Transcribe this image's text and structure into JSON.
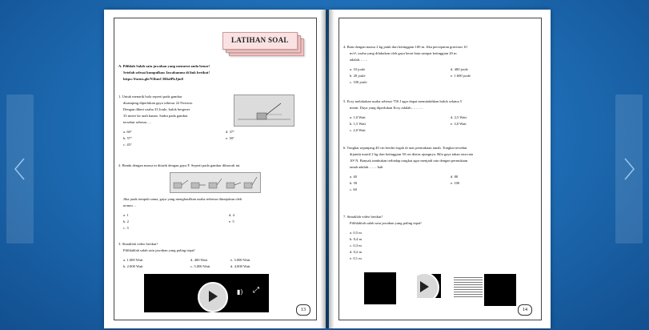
{
  "viewer": {
    "prev_icon": "chevron-left-icon",
    "next_icon": "chevron-right-icon"
  },
  "left_page": {
    "banner_title": "LATIHAN SOAL",
    "instruction_a": "A.  Pilihlah Salah satu jawaban yang menurut anda benar!",
    "instruction_b": "Setelah selesai kumpulkan Jawabanmu di link berikut!",
    "link": "https://forms.gle/N3hmC3RkdPkJjm8",
    "q1": [
      "1.  Untuk  menarik  bola  seperti  pada  gambar",
      "disamping diperlukan gaya sebesar 22 Newton.",
      "Dengan diberi usaha 33 Joule, balok bergeser",
      "33  meter  ke  arah  kanan.  Sudut  pada  gambar",
      "tersebut sebesar…."
    ],
    "q1_opts": [
      "a.  60°",
      "d.  37°",
      "b.  57°",
      "e.  30°",
      "c.  45°"
    ],
    "q2": "2.  Benda dengan massa m ditarik dengan gaya F. Seperti pada gambar dibawah ini.",
    "q2_text": [
      "Jika jarak tempuh sama, gaya yang menghasilkan usaha terbesar ditunjukan oleh",
      "nomor…"
    ],
    "q2_opts": [
      "a.  1",
      "d.  4",
      "b.  2",
      "e.  5",
      "c.  3"
    ],
    "q3": "3.  Simaklah video berikut!",
    "q3_text": "Pilihlahlah salah satu jawaban yang paling tepat!",
    "q3_opts": [
      "a.  1.000 Watt",
      "d.  400 Watt",
      "e.  3.000 Watt",
      "b.  2.000 Watt",
      "c.  5.000 Watt",
      "d.  4.000 Watt"
    ],
    "page_number": "13"
  },
  "right_page": {
    "q4": [
      "4.  Batu dengan massa 2 kg jatuh dari ketinggian 100 m. Jika percepatan gravitasi 10",
      "m/s², usaha yang dilakukan oleh gaya berat batu sampai ketinggian 20 m",
      "adalah……."
    ],
    "q4_opts": [
      "a.  10 joule",
      "d.  400 joule",
      "b.  20 joule",
      "e.  1.600 joule",
      "c.  100 joule"
    ],
    "q5": [
      "5.  Ecsy melakukan usaha sebesar 750 J agar dapat memindahkan balok selama 5",
      "menit. Daya yang diperlukan Ecsy adalah………."
    ],
    "q5_opts": [
      "a.  1,0 Watt",
      "d.  2,5 Watt",
      "b.  1,5 Watt",
      "e.  3,0 Watt",
      "c.  2,0 Watt"
    ],
    "q6": [
      "6.  Tongkat sepanjang 40 cm berdiri tegak di atas permukaan tanah. Tongkat tersebut",
      "dijatuhi martil 2 kg dari ketinggian 50 cm diatas ujungnya. Bila gaya tahan rata-rata",
      "10³ N. Banyak tumbukan terhadap tongkat agar menjadi rata dengan permukaan",
      "tanah adalah……. kali"
    ],
    "q6_opts": [
      "a.  40",
      "d.  80",
      "b.  50",
      "e.  100",
      "c.  60"
    ],
    "q7": "7.  Simaklah video berikut!",
    "q7_text": "Pilihlahlah salah satu jawaban yang paling tepat!",
    "q7_opts": [
      "a.  0,5 m",
      "b.  0,4 m",
      "c.  0,3 m",
      "d.  0,2 m",
      "e.  0,1 m"
    ],
    "page_number": "14"
  }
}
